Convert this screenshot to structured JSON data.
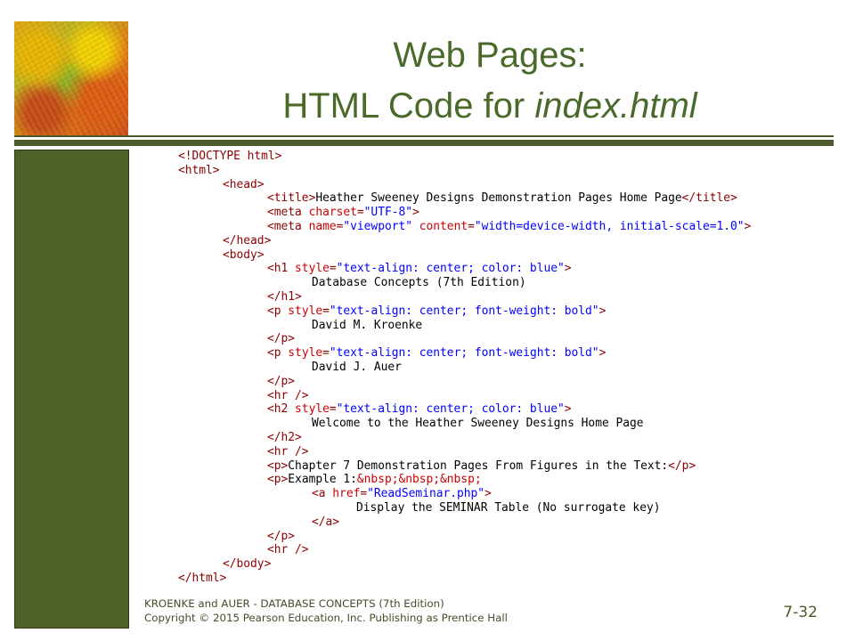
{
  "slide": {
    "title_line1": "Web Pages:",
    "title_line2_prefix": "HTML Code for ",
    "title_line2_italic": "index.html",
    "footer_line1": "KROENKE and AUER -  DATABASE CONCEPTS (7th Edition)",
    "footer_line2": "Copyright © 2015 Pearson Education, Inc. Publishing as Prentice Hall",
    "page_number": "7-32",
    "colors": {
      "title": "#4a6a2a",
      "rule": "#4d5c2c",
      "side_panel": "#4f6128",
      "tag": "#8b0000",
      "attr": "#cc0000",
      "value": "#0000ff"
    }
  },
  "code_lines": [
    {
      "indent": 0,
      "parts": [
        {
          "t": "tag",
          "v": "<!DOCTYPE html>"
        }
      ]
    },
    {
      "indent": 0,
      "parts": [
        {
          "t": "tag",
          "v": "<html>"
        }
      ]
    },
    {
      "indent": 1,
      "parts": [
        {
          "t": "tag",
          "v": "<head>"
        }
      ]
    },
    {
      "indent": 2,
      "parts": [
        {
          "t": "tag",
          "v": "<title>"
        },
        {
          "t": "txt",
          "v": "Heather Sweeney Designs Demonstration Pages Home Page"
        },
        {
          "t": "tag",
          "v": "</title>"
        }
      ]
    },
    {
      "indent": 2,
      "parts": [
        {
          "t": "tag",
          "v": "<meta "
        },
        {
          "t": "attr",
          "v": "charset"
        },
        {
          "t": "tag",
          "v": "="
        },
        {
          "t": "val",
          "v": "\"UTF-8\""
        },
        {
          "t": "tag",
          "v": ">"
        }
      ]
    },
    {
      "indent": 2,
      "parts": [
        {
          "t": "tag",
          "v": "<meta "
        },
        {
          "t": "attr",
          "v": "name"
        },
        {
          "t": "tag",
          "v": "="
        },
        {
          "t": "val",
          "v": "\"viewport\""
        },
        {
          "t": "tag",
          "v": " "
        },
        {
          "t": "attr",
          "v": "content"
        },
        {
          "t": "tag",
          "v": "="
        },
        {
          "t": "val",
          "v": "\"width=device-width, initial-scale=1.0\""
        },
        {
          "t": "tag",
          "v": ">"
        }
      ]
    },
    {
      "indent": 1,
      "parts": [
        {
          "t": "tag",
          "v": "</head>"
        }
      ]
    },
    {
      "indent": 1,
      "parts": [
        {
          "t": "tag",
          "v": "<body>"
        }
      ]
    },
    {
      "indent": 2,
      "parts": [
        {
          "t": "tag",
          "v": "<h1 "
        },
        {
          "t": "attr",
          "v": "style"
        },
        {
          "t": "tag",
          "v": "="
        },
        {
          "t": "val",
          "v": "\"text-align: center; color: blue\""
        },
        {
          "t": "tag",
          "v": ">"
        }
      ]
    },
    {
      "indent": 3,
      "parts": [
        {
          "t": "txt",
          "v": "Database Concepts (7th Edition)"
        }
      ]
    },
    {
      "indent": 2,
      "parts": [
        {
          "t": "tag",
          "v": "</h1>"
        }
      ]
    },
    {
      "indent": 2,
      "parts": [
        {
          "t": "tag",
          "v": "<p "
        },
        {
          "t": "attr",
          "v": "style"
        },
        {
          "t": "tag",
          "v": "="
        },
        {
          "t": "val",
          "v": "\"text-align: center; font-weight: bold\""
        },
        {
          "t": "tag",
          "v": ">"
        }
      ]
    },
    {
      "indent": 3,
      "parts": [
        {
          "t": "txt",
          "v": "David M. Kroenke"
        }
      ]
    },
    {
      "indent": 2,
      "parts": [
        {
          "t": "tag",
          "v": "</p>"
        }
      ]
    },
    {
      "indent": 2,
      "parts": [
        {
          "t": "tag",
          "v": "<p "
        },
        {
          "t": "attr",
          "v": "style"
        },
        {
          "t": "tag",
          "v": "="
        },
        {
          "t": "val",
          "v": "\"text-align: center; font-weight: bold\""
        },
        {
          "t": "tag",
          "v": ">"
        }
      ]
    },
    {
      "indent": 3,
      "parts": [
        {
          "t": "txt",
          "v": "David J. Auer"
        }
      ]
    },
    {
      "indent": 2,
      "parts": [
        {
          "t": "tag",
          "v": "</p>"
        }
      ]
    },
    {
      "indent": 2,
      "parts": [
        {
          "t": "tag",
          "v": "<hr />"
        }
      ]
    },
    {
      "indent": 2,
      "parts": [
        {
          "t": "tag",
          "v": "<h2 "
        },
        {
          "t": "attr",
          "v": "style"
        },
        {
          "t": "tag",
          "v": "="
        },
        {
          "t": "val",
          "v": "\"text-align: center; color: blue\""
        },
        {
          "t": "tag",
          "v": ">"
        }
      ]
    },
    {
      "indent": 3,
      "parts": [
        {
          "t": "txt",
          "v": "Welcome to the Heather Sweeney Designs Home Page"
        }
      ]
    },
    {
      "indent": 2,
      "parts": [
        {
          "t": "tag",
          "v": "</h2>"
        }
      ]
    },
    {
      "indent": 2,
      "parts": [
        {
          "t": "tag",
          "v": "<hr />"
        }
      ]
    },
    {
      "indent": 2,
      "parts": [
        {
          "t": "tag",
          "v": "<p>"
        },
        {
          "t": "txt",
          "v": "Chapter 7 Demonstration Pages From Figures in the Text:"
        },
        {
          "t": "tag",
          "v": "</p>"
        }
      ]
    },
    {
      "indent": 2,
      "parts": [
        {
          "t": "tag",
          "v": "<p>"
        },
        {
          "t": "txt",
          "v": "Example 1:"
        },
        {
          "t": "ent",
          "v": "&nbsp;&nbsp;&nbsp;"
        }
      ]
    },
    {
      "indent": 3,
      "parts": [
        {
          "t": "tag",
          "v": "<a "
        },
        {
          "t": "attr",
          "v": "href"
        },
        {
          "t": "tag",
          "v": "="
        },
        {
          "t": "val",
          "v": "\"ReadSeminar.php\""
        },
        {
          "t": "tag",
          "v": ">"
        }
      ]
    },
    {
      "indent": 4,
      "parts": [
        {
          "t": "txt",
          "v": "Display the SEMINAR Table (No surrogate key)"
        }
      ]
    },
    {
      "indent": 3,
      "parts": [
        {
          "t": "tag",
          "v": "</a>"
        }
      ]
    },
    {
      "indent": 2,
      "parts": [
        {
          "t": "tag",
          "v": "</p>"
        }
      ]
    },
    {
      "indent": 2,
      "parts": [
        {
          "t": "tag",
          "v": "<hr />"
        }
      ]
    },
    {
      "indent": 1,
      "parts": [
        {
          "t": "tag",
          "v": "</body>"
        }
      ]
    },
    {
      "indent": 0,
      "parts": [
        {
          "t": "tag",
          "v": "</html>"
        }
      ]
    }
  ]
}
